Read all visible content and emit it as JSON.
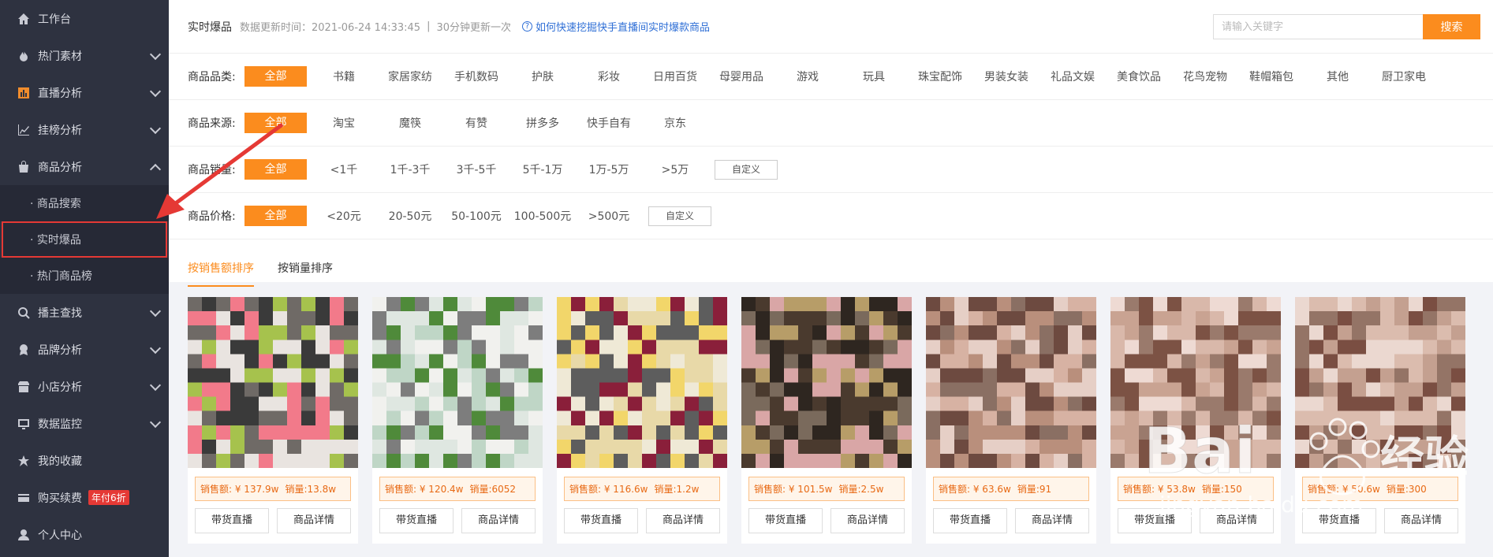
{
  "sidebar": {
    "items": [
      {
        "label": "工作台",
        "icon": "home-icon",
        "chevron": "none"
      },
      {
        "label": "热门素材",
        "icon": "fire-icon",
        "chevron": "down"
      },
      {
        "label": "直播分析",
        "icon": "bar-chart-icon",
        "chevron": "down"
      },
      {
        "label": "挂榜分析",
        "icon": "line-chart-icon",
        "chevron": "down"
      },
      {
        "label": "商品分析",
        "icon": "bag-icon",
        "chevron": "up"
      }
    ],
    "sub_items": [
      {
        "label": "· 商品搜索"
      },
      {
        "label": "· 实时爆品"
      },
      {
        "label": "· 热门商品榜"
      }
    ],
    "items_after": [
      {
        "label": "播主查找",
        "icon": "search-icon",
        "chevron": "down"
      },
      {
        "label": "品牌分析",
        "icon": "brand-icon",
        "chevron": "down"
      },
      {
        "label": "小店分析",
        "icon": "shop-icon",
        "chevron": "down"
      },
      {
        "label": "数据监控",
        "icon": "monitor-icon",
        "chevron": "down"
      },
      {
        "label": "我的收藏",
        "icon": "star-icon",
        "chevron": "none"
      },
      {
        "label": "购买续费",
        "icon": "card-icon",
        "chevron": "none",
        "badge": "年付6折"
      },
      {
        "label": "个人中心",
        "icon": "user-icon",
        "chevron": "none"
      }
    ]
  },
  "header": {
    "title": "实时爆品",
    "updated_label": "数据更新时间：2021-06-24 14:33:45",
    "separator": "|",
    "refresh_note": "30分钟更新一次",
    "help_link": "如何快速挖掘快手直播间实时爆款商品",
    "search_placeholder": "请输入关键字",
    "search_button": "搜索"
  },
  "filters": {
    "category": {
      "label": "商品品类:",
      "options": [
        "全部",
        "书籍",
        "家居家纺",
        "手机数码",
        "护肤",
        "彩妆",
        "日用百货",
        "母婴用品",
        "游戏",
        "玩具",
        "珠宝配饰",
        "男装女装",
        "礼品文娱",
        "美食饮品",
        "花鸟宠物",
        "鞋帽箱包",
        "其他",
        "厨卫家电"
      ]
    },
    "source": {
      "label": "商品来源:",
      "options": [
        "全部",
        "淘宝",
        "魔筷",
        "有赞",
        "拼多多",
        "快手自有",
        "京东"
      ]
    },
    "sales": {
      "label": "商品销量:",
      "options": [
        "全部",
        "<1千",
        "1千-3千",
        "3千-5千",
        "5千-1万",
        "1万-5万",
        ">5万"
      ],
      "custom": "自定义"
    },
    "price": {
      "label": "商品价格:",
      "options": [
        "全部",
        "<20元",
        "20-50元",
        "50-100元",
        "100-500元",
        ">500元"
      ],
      "custom": "自定义"
    }
  },
  "sort_tabs": [
    "按销售额排序",
    "按销量排序"
  ],
  "cards": [
    {
      "revenue": "销售额: ¥ 137.9w",
      "volume": "销量:13.8w",
      "btn_live": "带货直播",
      "btn_detail": "商品详情",
      "palette": [
        "#e9e4e0",
        "#6f6a66",
        "#a6c24d",
        "#f27a8a",
        "#3a3a3a"
      ]
    },
    {
      "revenue": "销售额: ¥ 120.4w",
      "volume": "销量:6052",
      "btn_live": "带货直播",
      "btn_detail": "商品详情",
      "palette": [
        "#f1f1ee",
        "#dfe7e1",
        "#4f8a3a",
        "#7d7d7d",
        "#bfd6c6"
      ]
    },
    {
      "revenue": "销售额: ¥ 116.6w",
      "volume": "销量:1.2w",
      "btn_live": "带货直播",
      "btn_detail": "商品详情",
      "palette": [
        "#efe9d6",
        "#e8d9a8",
        "#8a1f3a",
        "#5d5d5d",
        "#f2d66a"
      ]
    },
    {
      "revenue": "销售额: ¥ 101.5w",
      "volume": "销量:2.5w",
      "btn_live": "带货直播",
      "btn_detail": "商品详情",
      "palette": [
        "#d9a6a6",
        "#4a3a2e",
        "#b79d68",
        "#2e2620",
        "#7a6a5c"
      ]
    },
    {
      "revenue": "销售额: ¥ 63.6w",
      "volume": "销量:91",
      "btn_live": "带货直播",
      "btn_detail": "商品详情",
      "palette": [
        "#b98f7c",
        "#e6cfc6",
        "#6d4a40",
        "#d7b2a3",
        "#8a6f63"
      ]
    },
    {
      "revenue": "销售额: ¥ 53.8w",
      "volume": "销量:150",
      "btn_live": "带货直播",
      "btn_detail": "商品详情",
      "palette": [
        "#c9a392",
        "#eedad3",
        "#7c5244",
        "#d9b8aa",
        "#9a7a6c"
      ]
    },
    {
      "revenue": "销售额: ¥ 50.6w",
      "volume": "销量:300",
      "btn_live": "带货直播",
      "btn_detail": "商品详情",
      "palette": [
        "#c4a090",
        "#ebd8d0",
        "#7a4e42",
        "#dbbcae",
        "#947466"
      ]
    }
  ],
  "watermark": {
    "text": "Bai",
    "text2": "经验",
    "url": "jingyan.baidu.com"
  },
  "colors": {
    "accent": "#fb8c1e",
    "sidebar_bg": "#2e3240",
    "highlight": "#e53935",
    "link": "#2f6fd6"
  }
}
